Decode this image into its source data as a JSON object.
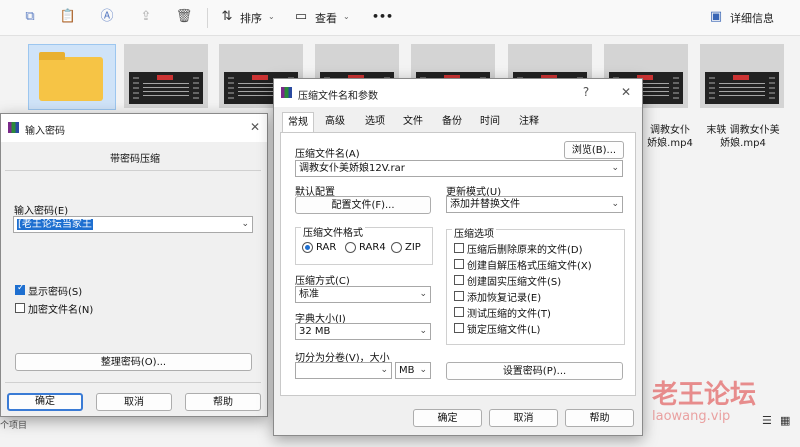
{
  "toolbar": {
    "sort_label": "排序",
    "view_label": "查看",
    "more_label": "•••",
    "details_label": "详细信息"
  },
  "files": [
    {
      "name": "",
      "type": "folder"
    },
    {
      "name": "",
      "type": "video"
    },
    {
      "name": "",
      "type": "video"
    },
    {
      "name": "",
      "type": "video"
    },
    {
      "name": "",
      "type": "video"
    },
    {
      "name": "",
      "type": "video"
    },
    {
      "name": "调教女仆美娇娘.mp4",
      "type": "video"
    },
    {
      "name": "末轶 调教女仆美娇娘.mp4",
      "type": "video"
    }
  ],
  "partial_labels": {
    "file6_line1": "调教女仆",
    "file6_line2": "娇娘.mp4",
    "file7_line1": "末轶 调教女仆美",
    "file7_line2": "娇娘.mp4"
  },
  "status": {
    "items": "个项目"
  },
  "watermark": {
    "text": "老王论坛",
    "sub": "laowang.vip"
  },
  "password_dialog": {
    "title": "输入密码",
    "heading": "带密码压缩",
    "input_label": "输入密码(E)",
    "input_value": "[老王论坛当家王",
    "show_password": "显示密码(S)",
    "show_password_checked": true,
    "encrypt_names": "加密文件名(N)",
    "encrypt_names_checked": false,
    "organize": "整理密码(O)...",
    "ok": "确定",
    "cancel": "取消",
    "help": "帮助"
  },
  "archive_dialog": {
    "title": "压缩文件名和参数",
    "tabs": [
      "常规",
      "高级",
      "选项",
      "文件",
      "备份",
      "时间",
      "注释"
    ],
    "archive_name_label": "压缩文件名(A)",
    "browse": "浏览(B)...",
    "archive_name_value": "调教女仆美娇娘12V.rar",
    "default_config_label": "默认配置",
    "config_file_button": "配置文件(F)...",
    "update_mode_label": "更新模式(U)",
    "update_mode_value": "添加并替换文件",
    "format_group": "压缩文件格式",
    "formats": [
      "RAR",
      "RAR4",
      "ZIP"
    ],
    "selected_format": "RAR",
    "options_group": "压缩选项",
    "options": [
      {
        "label": "压缩后删除原来的文件(D)",
        "checked": false
      },
      {
        "label": "创建自解压格式压缩文件(X)",
        "checked": false
      },
      {
        "label": "创建固实压缩文件(S)",
        "checked": false
      },
      {
        "label": "添加恢复记录(E)",
        "checked": false
      },
      {
        "label": "测试压缩的文件(T)",
        "checked": false
      },
      {
        "label": "锁定压缩文件(L)",
        "checked": false
      }
    ],
    "method_label": "压缩方式(C)",
    "method_value": "标准",
    "dict_label": "字典大小(I)",
    "dict_value": "32 MB",
    "split_label": "切分为分卷(V)，大小",
    "split_value": "",
    "split_unit": "MB",
    "set_password": "设置密码(P)...",
    "ok": "确定",
    "cancel": "取消",
    "help": "帮助"
  },
  "colors": {
    "accent": "#1e6fd0",
    "watermark": "#e46a6a"
  }
}
